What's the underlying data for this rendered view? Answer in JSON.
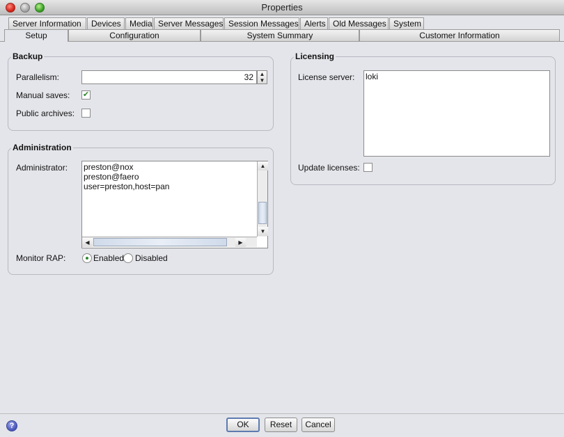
{
  "window": {
    "title": "Properties"
  },
  "tabs_top": [
    {
      "label": "Server Information"
    },
    {
      "label": "Devices"
    },
    {
      "label": "Media"
    },
    {
      "label": "Server Messages"
    },
    {
      "label": "Session Messages"
    },
    {
      "label": "Alerts"
    },
    {
      "label": "Old Messages"
    },
    {
      "label": "System"
    }
  ],
  "tabs_bottom": [
    {
      "label": "Setup",
      "selected": true
    },
    {
      "label": "Configuration"
    },
    {
      "label": "System Summary"
    },
    {
      "label": "Customer Information"
    }
  ],
  "backup": {
    "title": "Backup",
    "parallelism_label": "Parallelism:",
    "parallelism_value": "32",
    "manual_saves_label": "Manual saves:",
    "manual_saves_checked": true,
    "public_archives_label": "Public archives:",
    "public_archives_checked": false
  },
  "administration": {
    "title": "Administration",
    "administrator_label": "Administrator:",
    "administrators": [
      "preston@nox",
      "preston@faero",
      "user=preston,host=pan"
    ],
    "monitor_rap_label": "Monitor RAP:",
    "enabled_label": "Enabled",
    "disabled_label": "Disabled",
    "monitor_rap_value": "Enabled"
  },
  "licensing": {
    "title": "Licensing",
    "license_server_label": "License server:",
    "license_server_value": "loki",
    "update_licenses_label": "Update licenses:",
    "update_licenses_checked": false
  },
  "buttons": {
    "ok": "OK",
    "reset": "Reset",
    "cancel": "Cancel",
    "help": "?"
  },
  "icons": {
    "check_glyph": "✔",
    "up_arrow": "▲",
    "down_arrow": "▼",
    "left_arrow": "◀",
    "right_arrow": "▶"
  }
}
